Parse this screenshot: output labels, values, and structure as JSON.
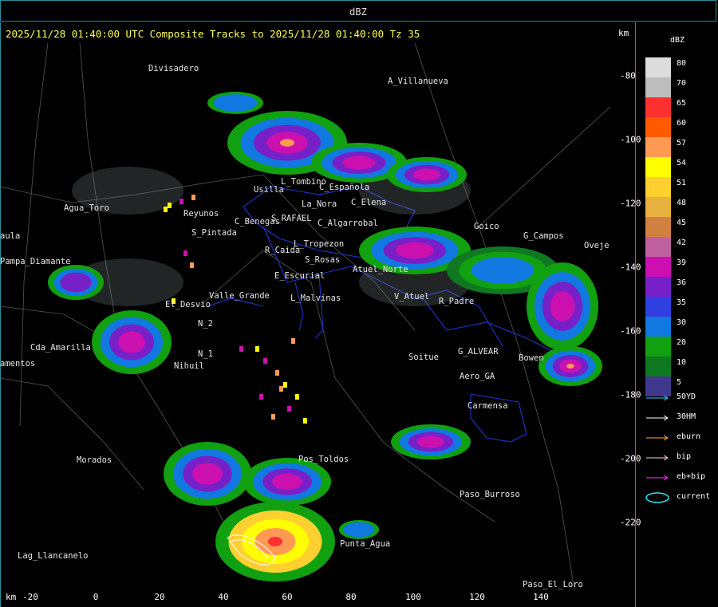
{
  "window": {
    "title": "dBZ"
  },
  "header": {
    "text": "2025/11/28 01:40:00 UTC Composite Tracks to 2025/11/28 01:40:00 Tz 35",
    "unit_top": "km",
    "unit_bottom": "km"
  },
  "axes": {
    "x_ticks": [
      "-20",
      "0",
      "20",
      "40",
      "60",
      "80",
      "100",
      "120",
      "140"
    ],
    "y_ticks": [
      "-80",
      "-100",
      "-120",
      "-140",
      "-160",
      "-180",
      "-200",
      "-220"
    ]
  },
  "places": [
    {
      "name": "Divisadero"
    },
    {
      "name": "A_Villanueva"
    },
    {
      "name": "L_Tombino"
    },
    {
      "name": "C_Española"
    },
    {
      "name": "Usilla"
    },
    {
      "name": "La_Nora"
    },
    {
      "name": "C_Elena"
    },
    {
      "name": "Reyunos"
    },
    {
      "name": "S_Pintada"
    },
    {
      "name": "C_Benegas"
    },
    {
      "name": "S_RAFAEL"
    },
    {
      "name": "C_Algarrobal"
    },
    {
      "name": "R_Caida"
    },
    {
      "name": "L_Tropezon"
    },
    {
      "name": "S_Rosas"
    },
    {
      "name": "Goico"
    },
    {
      "name": "G_Campos"
    },
    {
      "name": "Oveje"
    },
    {
      "name": "Pampa_Diamante"
    },
    {
      "name": "Agua_Toro"
    },
    {
      "name": "E_Escurial"
    },
    {
      "name": "Atuel_Norte"
    },
    {
      "name": "Valle_Grande"
    },
    {
      "name": "L_Malvinas"
    },
    {
      "name": "V_Atuel"
    },
    {
      "name": "R_Padre"
    },
    {
      "name": "El_Desvio"
    },
    {
      "name": "N_2"
    },
    {
      "name": "N_1"
    },
    {
      "name": "Nihuil"
    },
    {
      "name": "Cda_Amarilla"
    },
    {
      "name": "Soitue"
    },
    {
      "name": "G_ALVEAR"
    },
    {
      "name": "Aero_GA"
    },
    {
      "name": "Bowen"
    },
    {
      "name": "Carmensa"
    },
    {
      "name": "Morados"
    },
    {
      "name": "Paso_Burroso"
    },
    {
      "name": "Punta_Agua"
    },
    {
      "name": "Lag_Llancanelo"
    },
    {
      "name": "Paso_El_Loro"
    },
    {
      "name": "Pos_Toldos"
    },
    {
      "name": "aula"
    },
    {
      "name": "amentos"
    }
  ],
  "legend": {
    "title": "dBZ",
    "levels": [
      {
        "value": "80",
        "color": "#dcdcdc"
      },
      {
        "value": "70",
        "color": "#bdbdbd"
      },
      {
        "value": "65",
        "color": "#ff3030"
      },
      {
        "value": "60",
        "color": "#ff5a00"
      },
      {
        "value": "57",
        "color": "#ff9a55"
      },
      {
        "value": "54",
        "color": "#ffff00"
      },
      {
        "value": "51",
        "color": "#ffd030"
      },
      {
        "value": "48",
        "color": "#e8b040"
      },
      {
        "value": "45",
        "color": "#d08040"
      },
      {
        "value": "42",
        "color": "#c060a0"
      },
      {
        "value": "39",
        "color": "#cc10b0"
      },
      {
        "value": "36",
        "color": "#7820c8"
      },
      {
        "value": "35",
        "color": "#3040e0"
      },
      {
        "value": "30",
        "color": "#1078e0"
      },
      {
        "value": "20",
        "color": "#10a010"
      },
      {
        "value": "10",
        "color": "#107820"
      },
      {
        "value": "5",
        "color": "#40388c"
      }
    ],
    "tracks": [
      {
        "label": "50YD",
        "color": "#30d0ff"
      },
      {
        "label": "30HM",
        "color": "#ffffff"
      },
      {
        "label": "eburn",
        "color": "#ffb030"
      },
      {
        "label": "bip",
        "color": "#ffd0d0"
      },
      {
        "label": "eb+bip",
        "color": "#ff30ff"
      },
      {
        "label": "current",
        "color": "#30e0ff"
      }
    ]
  }
}
